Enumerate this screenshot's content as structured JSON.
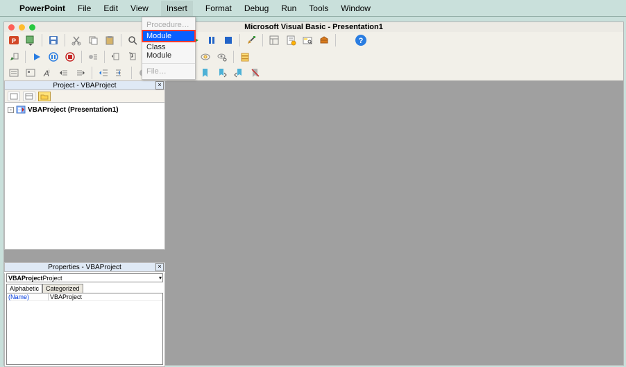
{
  "menubar": {
    "app": "PowerPoint",
    "items": [
      "File",
      "Edit",
      "View",
      "Insert",
      "Format",
      "Debug",
      "Run",
      "Tools",
      "Window"
    ],
    "open_index": 3
  },
  "dropdown": {
    "items": [
      {
        "label": "Procedure…",
        "disabled": true
      },
      {
        "label": "Module",
        "selected": true
      },
      {
        "label": "Class Module"
      },
      {
        "sep": true
      },
      {
        "label": "File…",
        "disabled": true
      }
    ]
  },
  "window": {
    "title": "Microsoft Visual Basic - Presentation1"
  },
  "project_panel": {
    "title": "Project - VBAProject",
    "root": "VBAProject (Presentation1)"
  },
  "properties_panel": {
    "title": "Properties - VBAProject",
    "selector_bold": "VBAProject",
    "selector_rest": " Project",
    "tabs": [
      "Alphabetic",
      "Categorized"
    ],
    "rows": [
      {
        "key": "(Name)",
        "value": "VBAProject"
      }
    ]
  }
}
